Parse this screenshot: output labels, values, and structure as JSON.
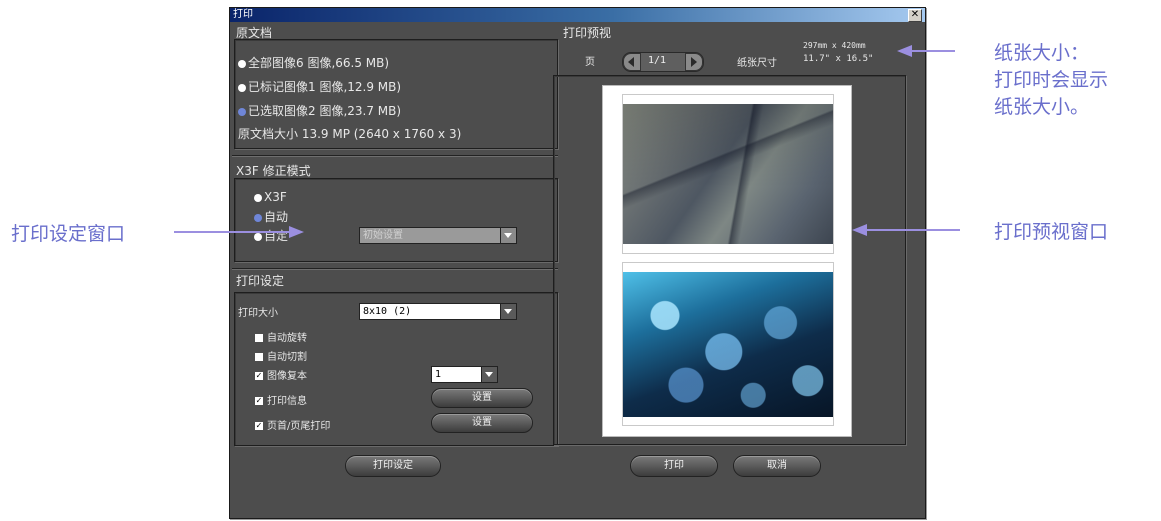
{
  "dialog": {
    "title": "打印",
    "close_glyph": "✕",
    "source": {
      "heading": "原文档",
      "options": [
        {
          "label": "全部图像6 图像,66.5 MB)",
          "radio": "white"
        },
        {
          "label": "已标记图像1 图像,12.9 MB)",
          "radio": "white"
        },
        {
          "label": "已选取图像2 图像,23.7 MB)",
          "radio": "blue"
        }
      ],
      "size_text": "原文档大小 13.9 MP (2640 x 1760 x 3)"
    },
    "correction": {
      "heading": "X3F 修正模式",
      "options": [
        "X3F",
        "自动",
        "自定"
      ],
      "preset_value": "初始设置"
    },
    "print_settings": {
      "heading": "打印设定",
      "print_size_label": "打印大小",
      "print_size_value": "8x10 (2)",
      "auto_rotate": "自动旋转",
      "auto_crop": "自动切割",
      "copies_label": "图像复本",
      "copies_value": "1",
      "print_info": "打印信息",
      "header_footer": "页首/页尾打印",
      "setup_button": "设置",
      "bottom_button": "打印设定"
    },
    "preview": {
      "heading": "打印预视",
      "page_label": "页",
      "page_value": "1/1",
      "paper_size_label": "纸张尺寸",
      "paper_mm": "297mm x 420mm",
      "paper_in": "11.7\" x 16.5\""
    },
    "print_button": "打印",
    "cancel_button": "取消"
  },
  "callouts": {
    "paper_size_line1": "纸张大小：",
    "paper_size_line2": "打印时会显示",
    "paper_size_line3": "纸张大小。",
    "print_settings_window": "打印设定窗口",
    "print_preview_window": "打印预视窗口"
  },
  "colors": {
    "callout": "#6a6fcc",
    "arrow": "#9b8fe0",
    "dialog_bg": "#4d4d4d"
  }
}
